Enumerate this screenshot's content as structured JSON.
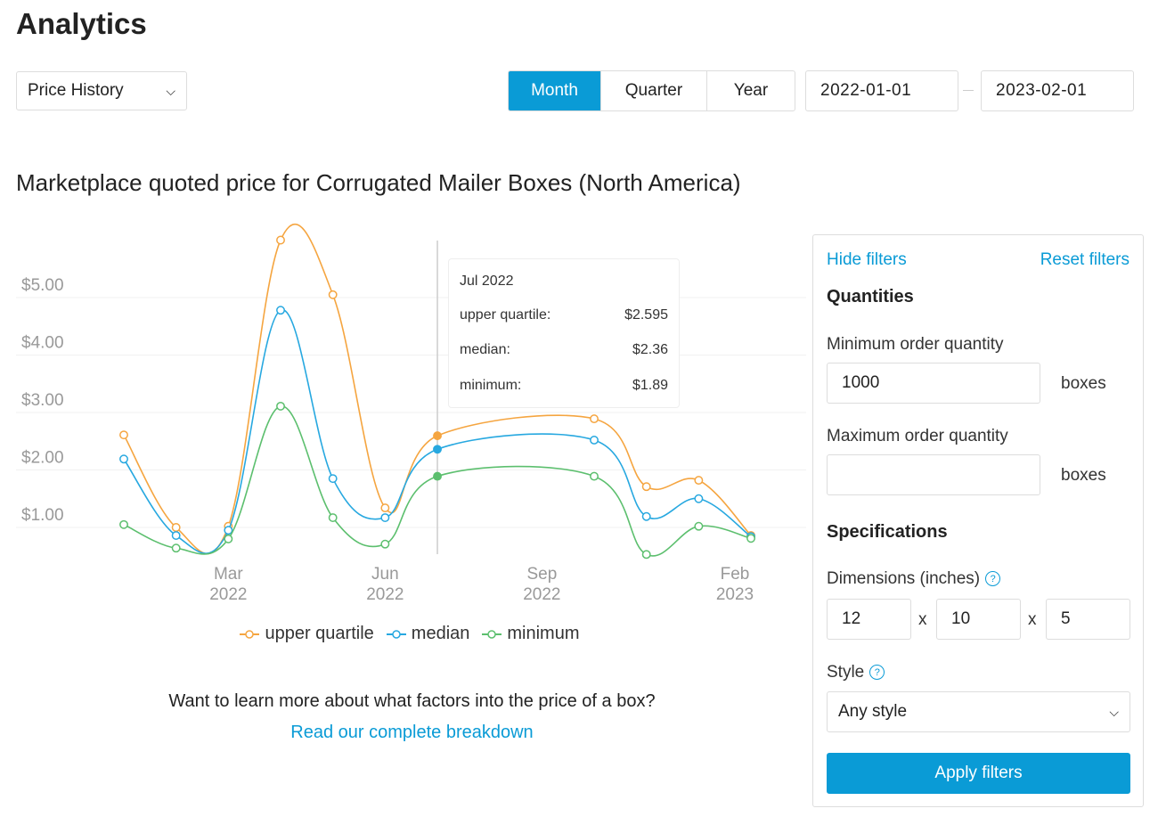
{
  "header": {
    "title": "Analytics"
  },
  "report_select": {
    "value": "Price History"
  },
  "period_tabs": [
    {
      "label": "Month",
      "active": true
    },
    {
      "label": "Quarter",
      "active": false
    },
    {
      "label": "Year",
      "active": false
    }
  ],
  "date_range": {
    "start": "2022-01-01",
    "end": "2023-02-01"
  },
  "chart_title": "Marketplace quoted price for Corrugated Mailer Boxes (North America)",
  "tooltip": {
    "title": "Jul 2022",
    "rows": [
      {
        "label": "upper quartile:",
        "value": "$2.595"
      },
      {
        "label": "median:",
        "value": "$2.36"
      },
      {
        "label": "minimum:",
        "value": "$1.89"
      }
    ]
  },
  "chart_data": {
    "type": "line",
    "x": [
      "2022-01",
      "2022-02",
      "2022-03",
      "2022-04",
      "2022-05",
      "2022-06",
      "2022-07",
      "2022-10",
      "2022-11",
      "2022-12",
      "2023-01"
    ],
    "series": [
      {
        "name": "upper quartile",
        "color": "#f5a540",
        "values": [
          2.61,
          1.0,
          1.02,
          6.0,
          5.05,
          1.34,
          2.595,
          2.89,
          1.71,
          1.82,
          0.86
        ]
      },
      {
        "name": "median",
        "color": "#27a8e0",
        "values": [
          2.19,
          0.86,
          0.95,
          4.78,
          1.85,
          1.17,
          2.36,
          2.52,
          1.19,
          1.5,
          0.84
        ]
      },
      {
        "name": "minimum",
        "color": "#5cbf6e",
        "values": [
          1.05,
          0.64,
          0.8,
          3.11,
          1.17,
          0.71,
          1.89,
          1.89,
          0.53,
          1.02,
          0.81
        ]
      }
    ],
    "y_ticks": [
      "$1.00",
      "$2.00",
      "$3.00",
      "$4.00",
      "$5.00"
    ],
    "y_tick_values": [
      1,
      2,
      3,
      4,
      5
    ],
    "x_ticks": [
      {
        "month": "2022-03",
        "line1": "Mar",
        "line2": "2022"
      },
      {
        "month": "2022-06",
        "line1": "Jun",
        "line2": "2022"
      },
      {
        "month": "2022-09",
        "line1": "Sep",
        "line2": "2022"
      },
      {
        "month": "2023-02",
        "line1": "Feb",
        "line2": "2023"
      }
    ],
    "highlighted": "2022-07",
    "grid": true,
    "legend_placement": "bottom"
  },
  "cta": {
    "text": "Want to learn more about what factors into the price of a box?",
    "link": "Read our complete breakdown"
  },
  "filters": {
    "hide": "Hide filters",
    "reset": "Reset filters",
    "quantities_heading": "Quantities",
    "min_label": "Minimum order quantity",
    "min_value": "1000",
    "max_label": "Maximum order quantity",
    "max_value": "",
    "unit": "boxes",
    "spec_heading": "Specifications",
    "dimensions_label": "Dimensions (inches)",
    "dim_sep": "x",
    "dims": [
      "12",
      "10",
      "5"
    ],
    "style_label": "Style",
    "style_value": "Any style",
    "apply": "Apply filters"
  }
}
